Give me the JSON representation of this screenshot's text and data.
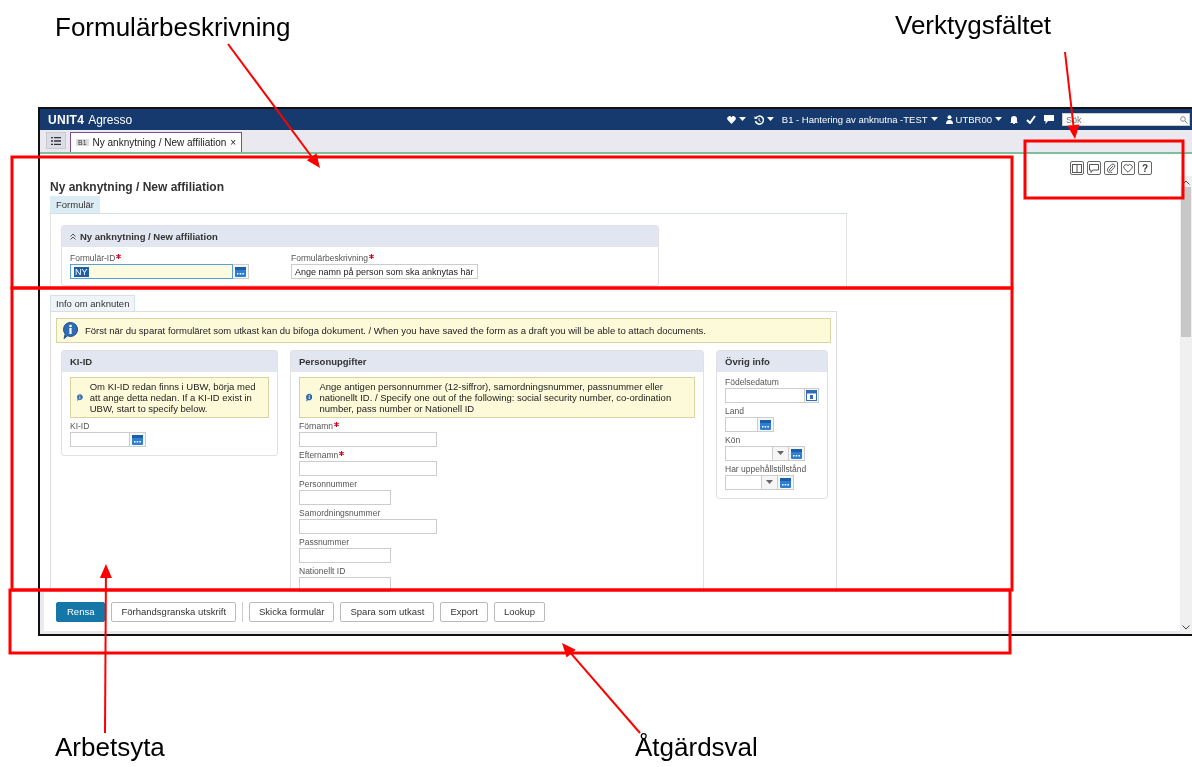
{
  "app": {
    "brand": "UNIT4",
    "product": "Agresso",
    "context": "B1 - Hantering av anknutna -TEST",
    "user": "UTBR00",
    "search": {
      "placeholder": "Sök"
    }
  },
  "window_tabs": [
    {
      "badge": "B1",
      "label": "Ny anknytning / New affiliation",
      "close": "×",
      "selected": true
    }
  ],
  "toolbar": {
    "help": "?"
  },
  "page_title": "Ny anknytning / New affiliation",
  "form_tabs": [
    {
      "label": "Formulär",
      "selected": true
    }
  ],
  "header_section": {
    "title": "Ny anknytning / New affiliation",
    "expanded": true,
    "fields": [
      {
        "label": "Formulär-ID",
        "required": true,
        "kind": "lookup",
        "value": "NY",
        "focused": true
      },
      {
        "label": "Formulärbeskrivning",
        "required": true,
        "kind": "text",
        "value": "Ange  namn på person som ska anknytas här",
        "focused": false
      }
    ]
  },
  "info_tab": {
    "label": "Info om anknuten",
    "selected": true
  },
  "info_note": "Först när du sparat formuläret som utkast kan du bifoga dokument. / When you have saved the form as a draft you will be able to attach documents.",
  "columns": [
    {
      "title": "KI-ID",
      "note": "Om KI-ID redan finns i UBW, börja med att ange detta nedan. If a KI-ID exist in UBW, start to specify below.",
      "fields": [
        {
          "label": "KI-ID",
          "required": false,
          "kind": "lookup"
        }
      ]
    },
    {
      "title": "Personupgifter",
      "note": "Ange antigen personnummer (12-siffror), samordningsnummer, passnummer eller nationellt ID. / Specify one out of the following: social security number, co-ordination number, pass number or Nationell ID",
      "fields": [
        {
          "label": "Förnamn",
          "required": true,
          "kind": "text"
        },
        {
          "label": "Efternamn",
          "required": true,
          "kind": "text"
        },
        {
          "label": "Personnummer",
          "required": false,
          "kind": "text"
        },
        {
          "label": "Samordningsnummer",
          "required": false,
          "kind": "text"
        },
        {
          "label": "Passnummer",
          "required": false,
          "kind": "text"
        },
        {
          "label": "Nationellt ID",
          "required": false,
          "kind": "text"
        }
      ]
    },
    {
      "title": "Övrig info",
      "fields": [
        {
          "label": "Födelsedatum",
          "required": false,
          "kind": "date"
        },
        {
          "label": "Land",
          "required": false,
          "kind": "lookup"
        },
        {
          "label": "Kön",
          "required": false,
          "kind": "dropdown"
        },
        {
          "label": "Har uppehållstillstånd",
          "required": false,
          "kind": "dropdown"
        }
      ]
    }
  ],
  "actions": [
    {
      "label": "Rensa",
      "kind": "primary",
      "divider_after": false
    },
    {
      "label": "Förhandsgranska utskrift",
      "kind": "default",
      "divider_after": true
    },
    {
      "label": "Skicka formulär",
      "kind": "default",
      "divider_after": false
    },
    {
      "label": "Spara som utkast",
      "kind": "default",
      "divider_after": false
    },
    {
      "label": "Export",
      "kind": "default",
      "divider_after": false
    },
    {
      "label": "Lookup",
      "kind": "default",
      "divider_after": false
    }
  ],
  "annotations": [
    {
      "label": "Formulärbeskrivning"
    },
    {
      "label": "Verktygsfältet"
    },
    {
      "label": "Arbetsyta"
    },
    {
      "label": "Åtgärdsval"
    }
  ]
}
